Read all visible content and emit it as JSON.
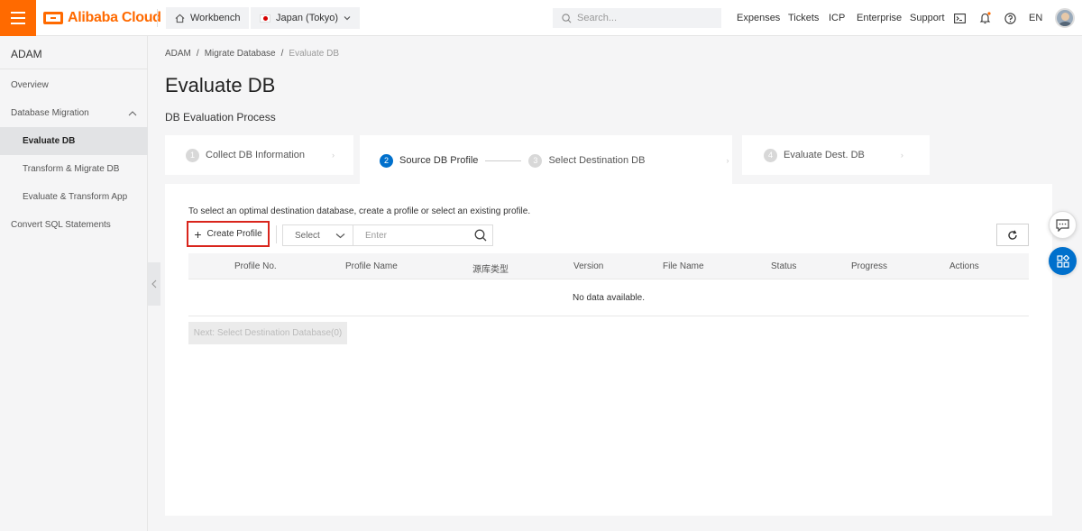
{
  "header": {
    "logo_text": "Alibaba Cloud",
    "workbench_label": "Workbench",
    "region_label": "Japan (Tokyo)",
    "search_placeholder": "Search...",
    "nav": [
      "Expenses",
      "Tickets",
      "ICP",
      "Enterprise",
      "Support"
    ],
    "language": "EN",
    "accent_color": "#ff6a00"
  },
  "sidebar": {
    "title": "ADAM",
    "items": [
      {
        "label": "Overview"
      },
      {
        "label": "Database Migration"
      },
      {
        "label": "Evaluate DB"
      },
      {
        "label": "Transform & Migrate DB"
      },
      {
        "label": "Evaluate & Transform App"
      },
      {
        "label": "Convert SQL Statements"
      }
    ]
  },
  "breadcrumb": {
    "items": [
      "ADAM",
      "Migrate Database",
      "Evaluate DB"
    ],
    "separator": "/"
  },
  "page": {
    "title": "Evaluate DB",
    "subtitle": "DB Evaluation Process"
  },
  "steps": [
    {
      "num": "1",
      "label": "Collect DB Information"
    },
    {
      "num": "2",
      "label": "Source DB Profile"
    },
    {
      "num": "3",
      "label": "Select Destination DB"
    },
    {
      "num": "4",
      "label": "Evaluate Dest. DB"
    }
  ],
  "panel": {
    "intro": "To select an optimal destination database, create a profile or select an existing profile.",
    "create_button": "Create Profile",
    "select_placeholder": "Select",
    "enter_placeholder": "Enter",
    "columns": [
      "Profile No.",
      "Profile Name",
      "源库类型",
      "Version",
      "File Name",
      "Status",
      "Progress",
      "Actions"
    ],
    "empty_text": "No data available.",
    "next_button": "Next: Select Destination Database(0)"
  },
  "icons": {
    "menu": "hamburger-icon",
    "workbench": "home-icon",
    "search": "search-icon",
    "terminal": "terminal-icon",
    "notification": "bell-icon",
    "help": "help-icon",
    "refresh": "refresh-icon",
    "chat": "chat-icon",
    "apps": "apps-icon"
  },
  "colors": {
    "primary": "#0070cc",
    "highlight_border": "#d9251c"
  }
}
